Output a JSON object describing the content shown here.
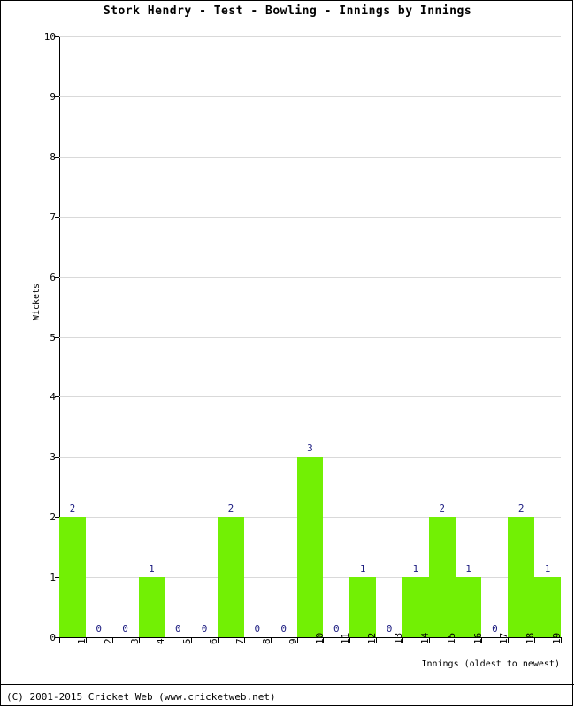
{
  "chart_data": {
    "type": "bar",
    "title": "Stork Hendry - Test - Bowling - Innings by Innings",
    "xlabel": "Innings (oldest to newest)",
    "ylabel": "Wickets",
    "categories": [
      "1",
      "2",
      "3",
      "4",
      "5",
      "6",
      "7",
      "8",
      "9",
      "10",
      "11",
      "12",
      "13",
      "14",
      "15",
      "16",
      "17",
      "18",
      "19"
    ],
    "values": [
      2,
      0,
      0,
      1,
      0,
      0,
      2,
      0,
      0,
      3,
      0,
      1,
      0,
      1,
      2,
      1,
      0,
      2,
      1
    ],
    "value_labels": [
      "2",
      "0",
      "0",
      "1",
      "0",
      "0",
      "2",
      "0",
      "0",
      "3",
      "0",
      "1",
      "0",
      "1",
      "2",
      "1",
      "0",
      "2",
      "1"
    ],
    "ylim": [
      0,
      10
    ],
    "yticks": [
      0,
      1,
      2,
      3,
      4,
      5,
      6,
      7,
      8,
      9,
      10
    ],
    "ytick_labels": [
      "0",
      "1",
      "2",
      "3",
      "4",
      "5",
      "6",
      "7",
      "8",
      "9",
      "10"
    ],
    "grid": true,
    "legend": false,
    "bar_color": "#72f004",
    "value_label_color": "#1b1b80",
    "gridline_color": "#d9d9d9",
    "axis_color": "#000000"
  },
  "footer": {
    "copyright": "(C) 2001-2015 Cricket Web (www.cricketweb.net)"
  }
}
